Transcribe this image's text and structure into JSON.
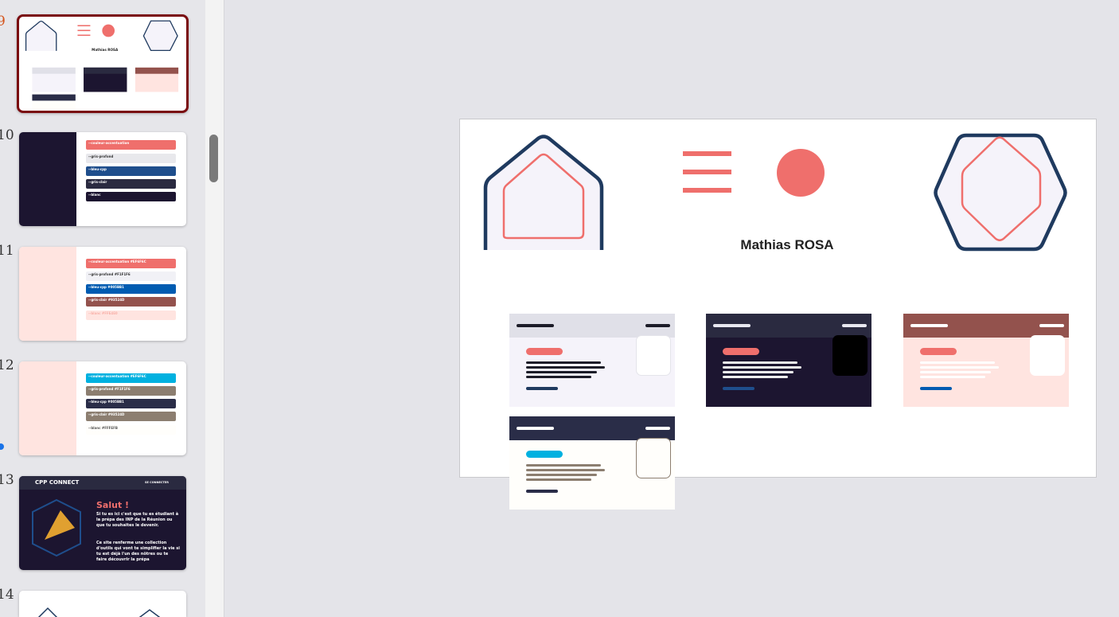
{
  "panel": {
    "slides": [
      {
        "number": "9",
        "selected": true
      },
      {
        "number": "10",
        "swatches": [
          "--couleur-accentuation",
          "--gris-profond",
          "--bleu-cpp",
          "--gris-clair",
          "--blanc"
        ]
      },
      {
        "number": "11",
        "swatches": [
          "--couleur-accentuation #EF6F6C",
          "--gris-profond #F1F1F6",
          "--bleu-cpp #005BB1",
          "--gris-clair #93524D",
          "--blanc #FFE4E0"
        ]
      },
      {
        "number": "12",
        "swatches": [
          "--couleur-accentuation #EF6F6C",
          "--gris-profond #F1F1F6",
          "--bleu-cpp #005BB1",
          "--gris-clair #93524D",
          "--blanc #FFFEFB"
        ]
      },
      {
        "number": "13",
        "app_name": "CPP CONNECT",
        "login": "SE CONNECTER",
        "greeting": "Salut !",
        "para1": "Si tu es ici c'est que tu es étudiant à la prépa des INP de la Réunion ou que tu souhaites le devenir.",
        "para2": "Ce site renferme une collection d'outils qui vont te simplifier la vie si tu est déjà l'un des nôtres ou te faire découvrir la prépa"
      },
      {
        "number": "14"
      }
    ]
  },
  "slide": {
    "name": "Mathias ROSA",
    "colors": {
      "accent": "#ef6f6c",
      "navy": "#1f3a5f",
      "lavender": "#f5f3fa",
      "dark": "#1c1530",
      "brown": "#93524d",
      "pink": "#ffe4e0",
      "cyan": "#00b1e0"
    }
  }
}
